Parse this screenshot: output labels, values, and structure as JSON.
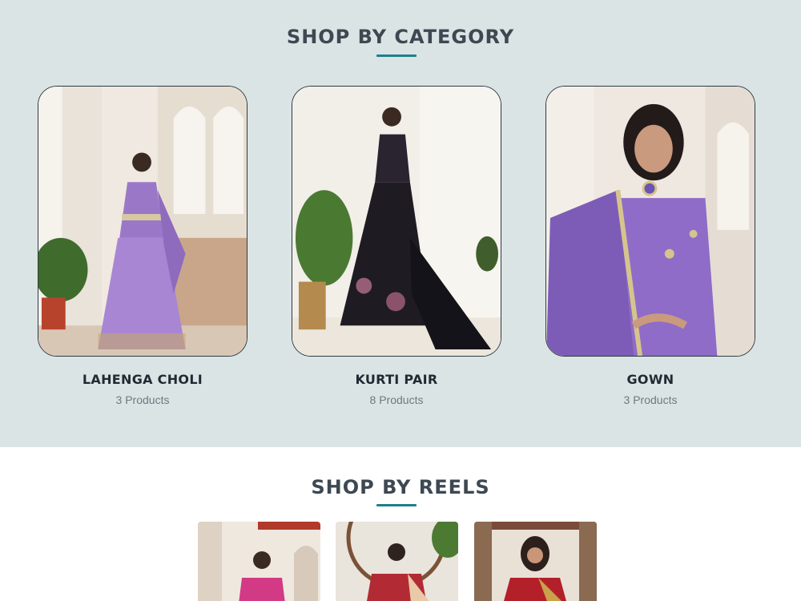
{
  "category_section": {
    "title": "SHOP BY CATEGORY",
    "cards": [
      {
        "name": "LAHENGA CHOLI",
        "count": "3 Products"
      },
      {
        "name": "KURTI PAIR",
        "count": "8 Products"
      },
      {
        "name": "GOWN",
        "count": "3 Products"
      }
    ]
  },
  "reels_section": {
    "title": "SHOP BY REELS"
  },
  "colors": {
    "section_bg": "#dae4e5",
    "accent_underline": "#1f7f8a",
    "heading_text": "#3d4852"
  }
}
